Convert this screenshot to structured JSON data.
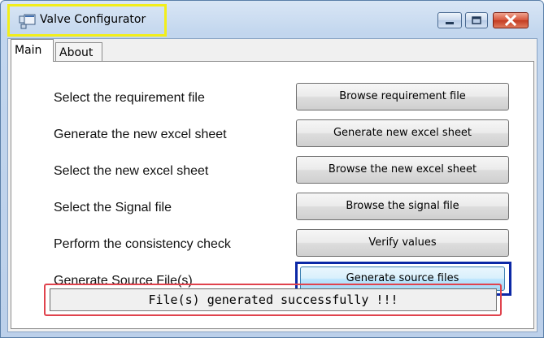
{
  "window": {
    "title": "Valve Configurator",
    "icon": "app-window-icon",
    "controls": [
      "minimize-icon",
      "maximize-icon",
      "close-icon"
    ]
  },
  "tabs": [
    {
      "label": "Main",
      "selected": true
    },
    {
      "label": "About",
      "selected": false
    }
  ],
  "rows": [
    {
      "label": "Select the requirement file",
      "button": "Browse requirement file"
    },
    {
      "label": "Generate the new excel sheet",
      "button": "Generate new excel sheet"
    },
    {
      "label": "Select the new excel sheet",
      "button": "Browse the new excel sheet"
    },
    {
      "label": "Select the Signal file",
      "button": "Browse the signal file"
    },
    {
      "label": "Perform the consistency check",
      "button": "Verify values"
    },
    {
      "label": "Generate Source File(s)",
      "button": "Generate source files"
    }
  ],
  "status": {
    "text": "File(s) generated successfully !!!"
  },
  "colors": {
    "title_highlight": "#f2ee1a",
    "focus_ring": "#0c28a6",
    "status_outline": "#e0434d",
    "close_button": "#c33c22"
  }
}
